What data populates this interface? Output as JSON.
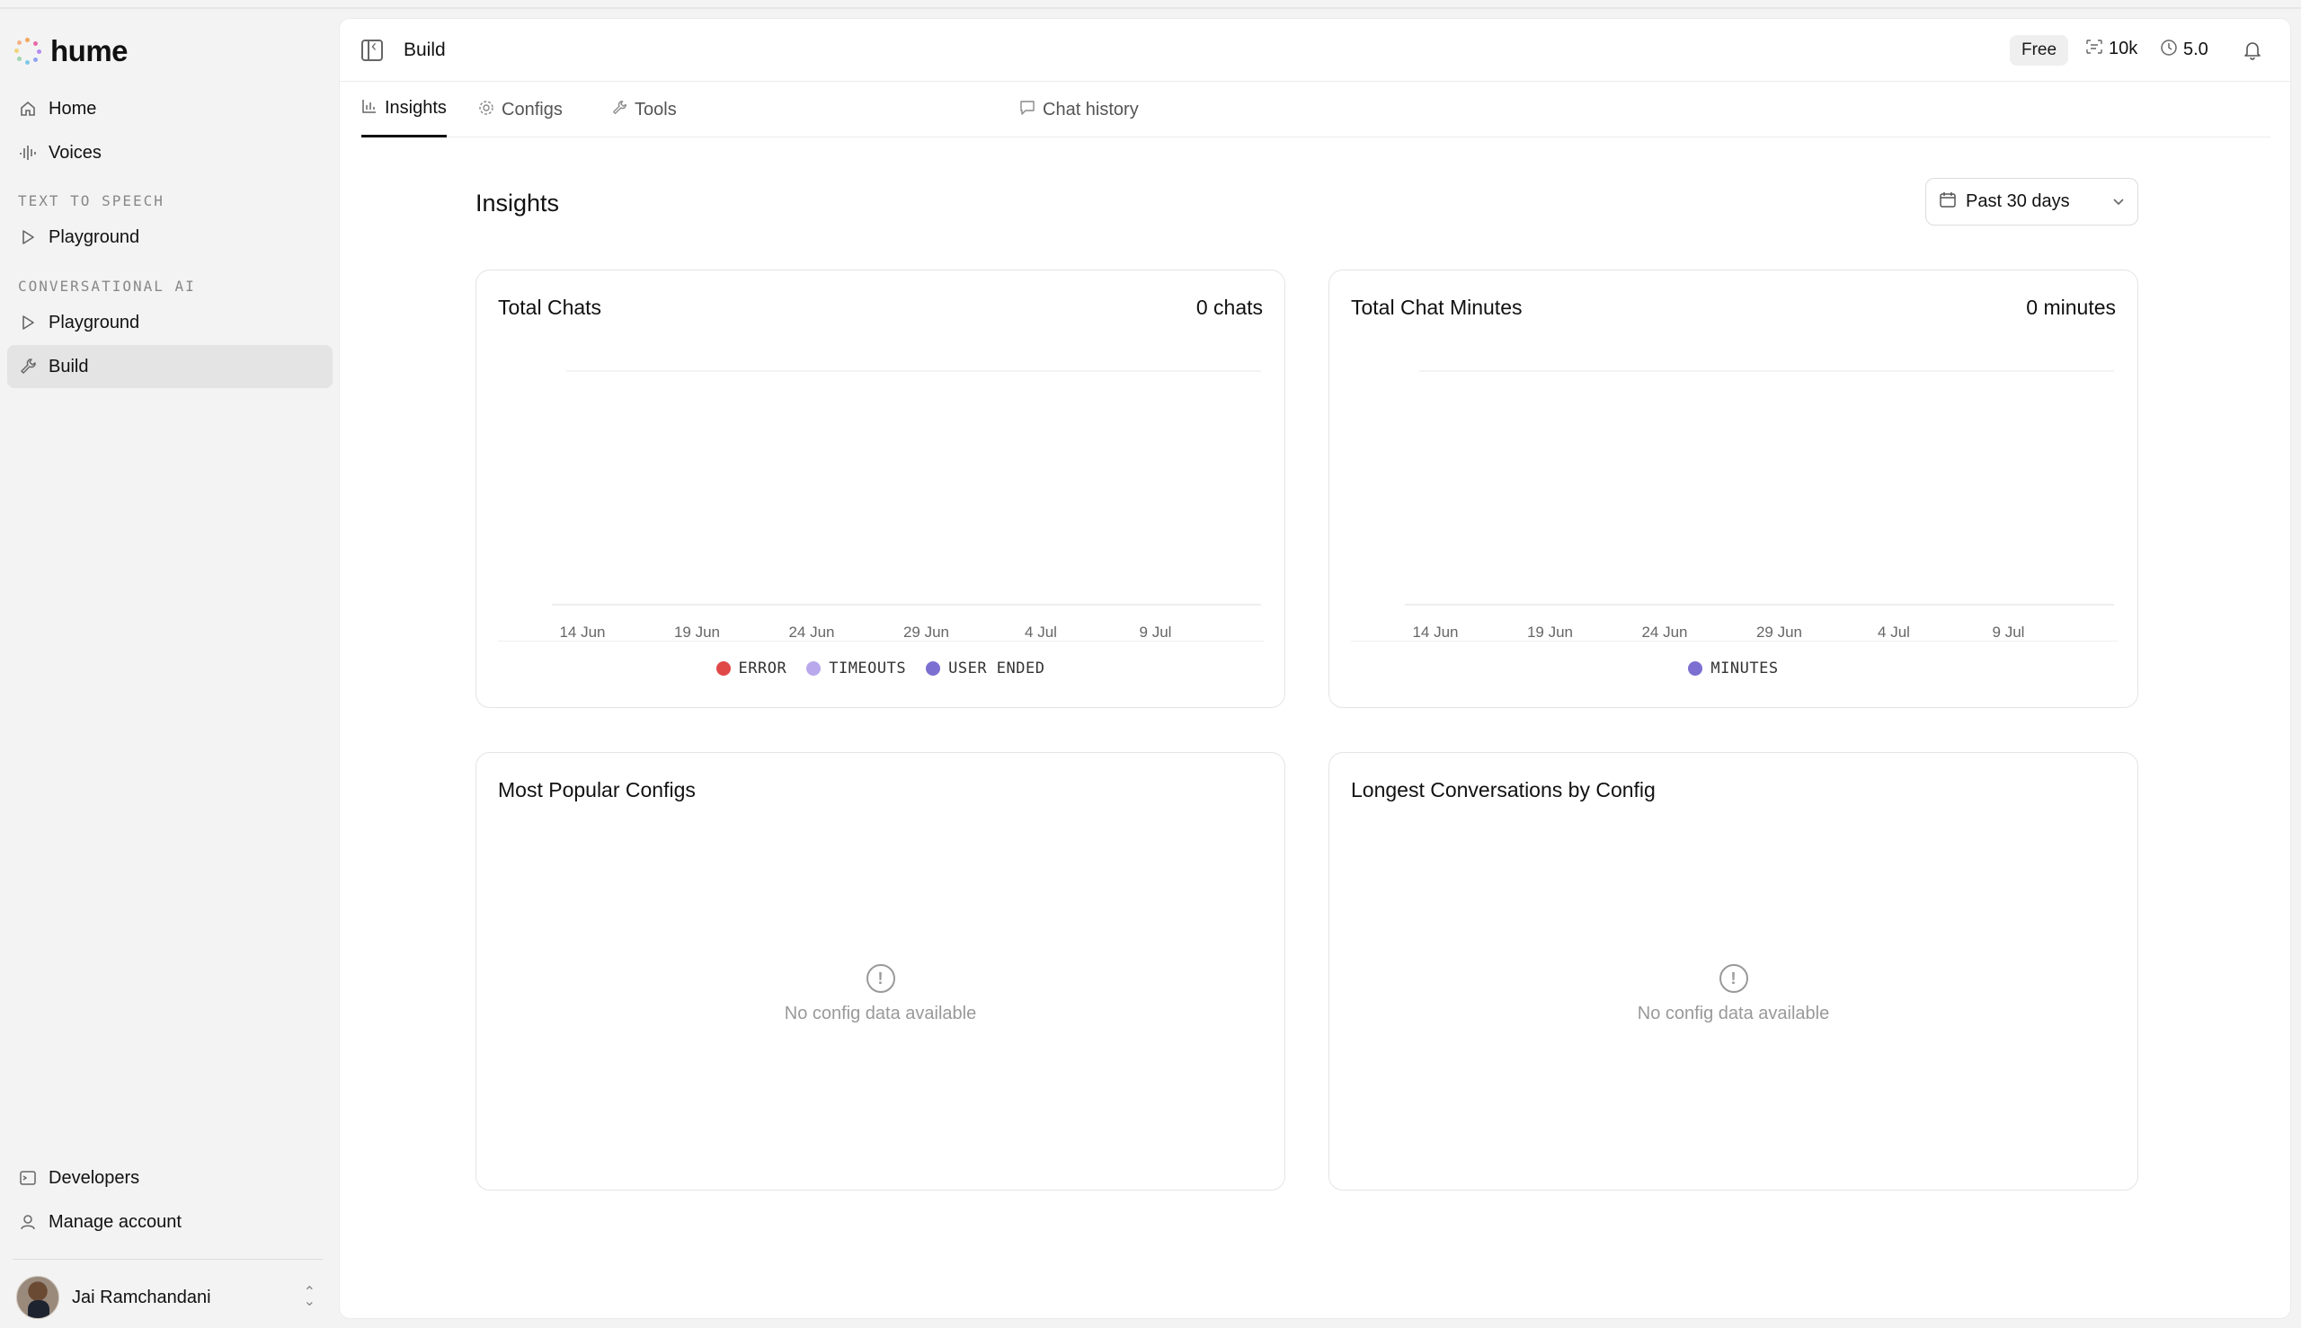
{
  "app": {
    "name": "hume"
  },
  "sidebar": {
    "items_top": [
      {
        "label": "Home",
        "icon": "home-icon"
      },
      {
        "label": "Voices",
        "icon": "waveform-icon"
      }
    ],
    "sections": [
      {
        "label": "TEXT TO SPEECH",
        "items": [
          {
            "label": "Playground",
            "icon": "play-icon"
          }
        ]
      },
      {
        "label": "CONVERSATIONAL AI",
        "items": [
          {
            "label": "Playground",
            "icon": "play-icon"
          },
          {
            "label": "Build",
            "icon": "wrench-icon",
            "active": true
          }
        ]
      }
    ],
    "items_bottom": [
      {
        "label": "Developers",
        "icon": "terminal-icon"
      },
      {
        "label": "Manage account",
        "icon": "user-icon"
      }
    ],
    "user": {
      "name": "Jai Ramchandani"
    }
  },
  "header": {
    "title": "Build",
    "plan": "Free",
    "characters": "10k",
    "minutes": "5.0"
  },
  "tabs": [
    {
      "label": "Insights",
      "icon": "bar-chart-icon",
      "active": true
    },
    {
      "label": "Configs",
      "icon": "gear-icon"
    },
    {
      "label": "Tools",
      "icon": "wrench-icon"
    },
    {
      "label": "Chat history",
      "icon": "chat-icon"
    }
  ],
  "page": {
    "title": "Insights",
    "range": "Past 30 days"
  },
  "cards": {
    "total_chats": {
      "title": "Total Chats",
      "value": "0 chats"
    },
    "total_minutes": {
      "title": "Total Chat Minutes",
      "value": "0 minutes"
    },
    "popular_configs": {
      "title": "Most Popular Configs",
      "empty": "No config data available"
    },
    "longest_conversations": {
      "title": "Longest Conversations by Config",
      "empty": "No config data available"
    }
  },
  "colors": {
    "error": "#e04848",
    "timeouts": "#b9a8ec",
    "user_ended": "#7c6fd2",
    "minutes": "#7c6fd2"
  },
  "chart_data": [
    {
      "type": "bar",
      "title": "Total Chats",
      "categories": [
        "14 Jun",
        "19 Jun",
        "24 Jun",
        "29 Jun",
        "4 Jul",
        "9 Jul"
      ],
      "series": [
        {
          "name": "ERROR",
          "values": [
            0,
            0,
            0,
            0,
            0,
            0
          ]
        },
        {
          "name": "TIMEOUTS",
          "values": [
            0,
            0,
            0,
            0,
            0,
            0
          ]
        },
        {
          "name": "USER ENDED",
          "values": [
            0,
            0,
            0,
            0,
            0,
            0
          ]
        }
      ],
      "legend": "bottom",
      "grid": true
    },
    {
      "type": "bar",
      "title": "Total Chat Minutes",
      "categories": [
        "14 Jun",
        "19 Jun",
        "24 Jun",
        "29 Jun",
        "4 Jul",
        "9 Jul"
      ],
      "series": [
        {
          "name": "MINUTES",
          "values": [
            0,
            0,
            0,
            0,
            0,
            0
          ]
        }
      ],
      "legend": "bottom",
      "grid": true
    }
  ]
}
